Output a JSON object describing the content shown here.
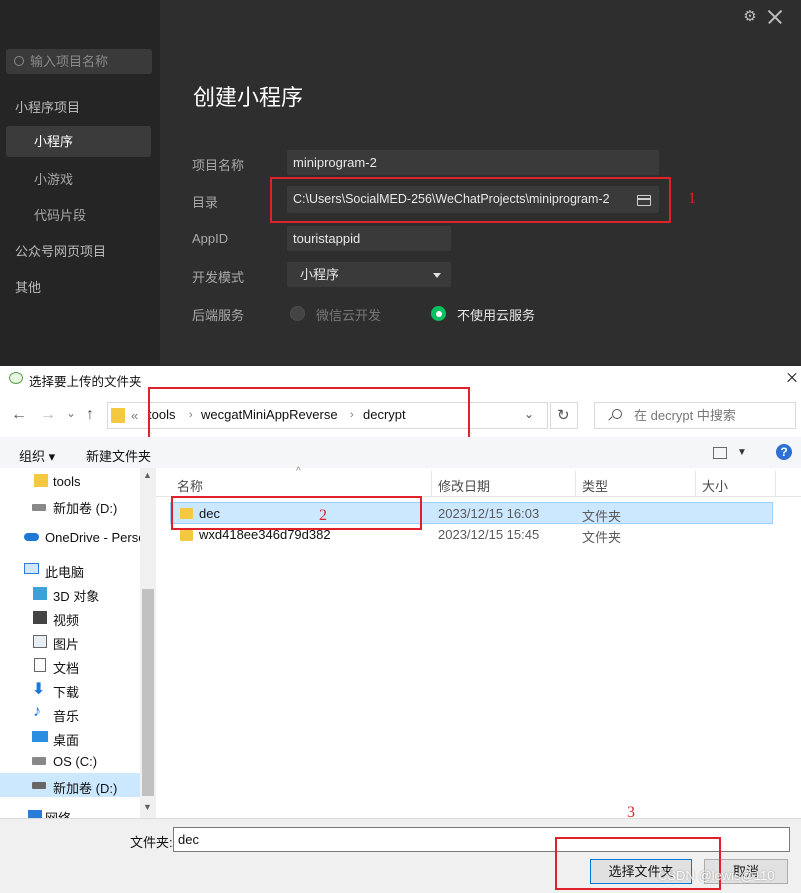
{
  "ide": {
    "search_placeholder": "输入项目名称",
    "sidebar": {
      "group_miniprogram": "小程序项目",
      "item_miniprogram": "小程序",
      "item_minigame": "小游戏",
      "item_snippet": "代码片段",
      "group_webpage": "公众号网页项目",
      "group_other": "其他"
    },
    "title": "创建小程序",
    "form": {
      "name_label": "项目名称",
      "name_value": "miniprogram-2",
      "dir_label": "目录",
      "dir_value": "C:\\Users\\SocialMED-256\\WeChatProjects\\miniprogram-2",
      "appid_label": "AppID",
      "appid_value": "touristappid",
      "mode_label": "开发模式",
      "mode_value": "小程序",
      "backend_label": "后端服务",
      "backend_option_cloud": "微信云开发",
      "backend_option_none": "不使用云服务",
      "backend_selected": "不使用云服务"
    },
    "accent_color": "#07c160"
  },
  "annotations": {
    "n1": "1",
    "n2": "2",
    "n3": "3",
    "color": "#e0202a"
  },
  "dialog": {
    "title": "选择要上传的文件夹",
    "nav": {
      "back": "←",
      "forward": "→",
      "recent": "⌄",
      "up": "↑"
    },
    "address": {
      "overflow": "«",
      "crumbs": [
        "tools",
        "wecgatMiniAppReverse",
        "decrypt"
      ],
      "refresh": "↻"
    },
    "search_placeholder": "在 decrypt 中搜索",
    "toolbar": {
      "organize": "组织 ▾",
      "new_folder": "新建文件夹",
      "help": "?"
    },
    "tree": [
      {
        "label": "tools"
      },
      {
        "label": "新加卷 (D:)"
      },
      {
        "label": "OneDrive - Perso"
      },
      {
        "label": "此电脑"
      },
      {
        "label": "3D 对象"
      },
      {
        "label": "视频"
      },
      {
        "label": "图片"
      },
      {
        "label": "文档"
      },
      {
        "label": "下载"
      },
      {
        "label": "音乐"
      },
      {
        "label": "桌面"
      },
      {
        "label": "OS (C:)"
      },
      {
        "label": "新加卷 (D:)"
      },
      {
        "label": "网络"
      }
    ],
    "columns": {
      "name": "名称",
      "date": "修改日期",
      "type": "类型",
      "size": "大小"
    },
    "files": [
      {
        "name": "dec",
        "date": "2023/12/15 16:03",
        "type": "文件夹"
      },
      {
        "name": "wxd418ee346d79d382",
        "date": "2023/12/15 15:45",
        "type": "文件夹"
      }
    ],
    "folder_label": "文件夹:",
    "folder_value": "dec",
    "select_button": "选择文件夹",
    "cancel_button": "取消",
    "watermark": "CSDN @lewis@110"
  }
}
